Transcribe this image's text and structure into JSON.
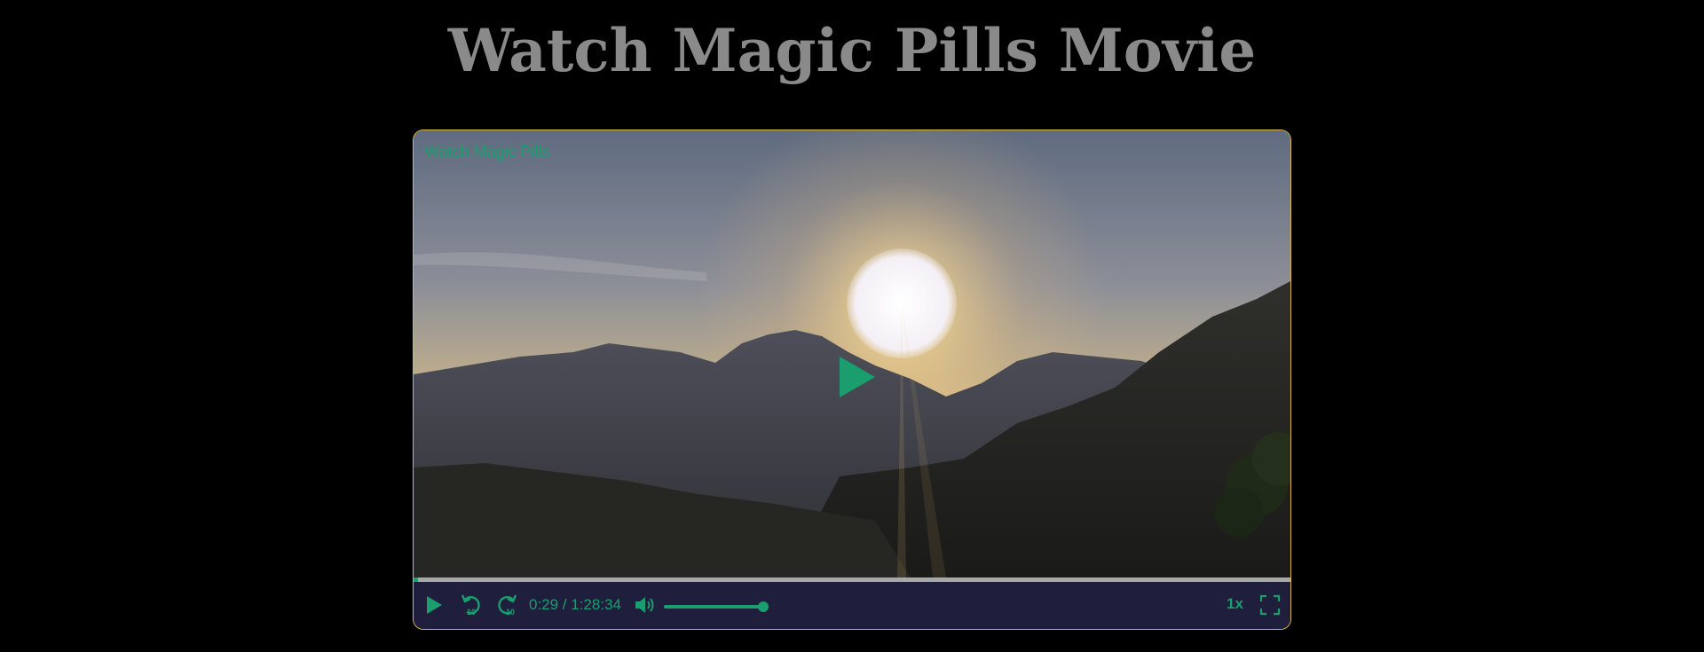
{
  "page": {
    "title": "Watch Magic Pills Movie"
  },
  "player": {
    "video_title": "Watch Magic Pills",
    "time_display": "0:29 / 1:28:34",
    "progress_fraction": 0.005,
    "volume_fraction": 1.0,
    "speed_label": "1x",
    "icons": {
      "play": "play-icon",
      "rewind": "rewind-10-icon",
      "forward": "forward-10-icon",
      "volume": "volume-icon",
      "fullscreen": "fullscreen-icon",
      "center_play": "play-icon"
    },
    "skip_label_back": "10",
    "skip_label_forward": "10"
  },
  "colors": {
    "accent": "#1a9e6e",
    "border": "#d9b64a",
    "controls_bg": "#1f1f3d",
    "title": "#8a8a8a"
  }
}
